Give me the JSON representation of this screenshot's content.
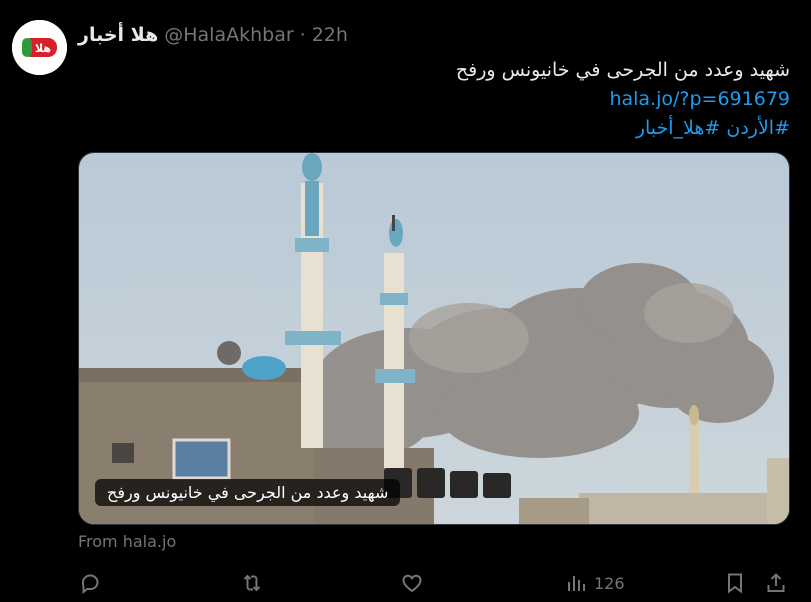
{
  "tweet": {
    "author_name": "هلا أخبار",
    "handle": "@HalaAkhbar",
    "separator": "·",
    "time": "22h",
    "avatar_text": "هلا",
    "text_line": "شهيد وعدد من الجرحى في خانيونس ورفح",
    "link": "hala.jo/?p=691679",
    "hashtags": "#الأردن #هلا_أخبار",
    "media_caption": "شهيد وعدد من الجرحى في خانيونس ورفح",
    "source": "From hala.jo"
  },
  "actions": {
    "views_count": "126"
  },
  "colors": {
    "background": "#000000",
    "text": "#e7e9ea",
    "muted": "#71767b",
    "link": "#1d9bf0",
    "brand_red": "#d6202a",
    "brand_green": "#2e9a3c"
  },
  "icons": [
    "reply-icon",
    "retweet-icon",
    "like-icon",
    "views-icon",
    "bookmark-icon",
    "share-icon"
  ]
}
